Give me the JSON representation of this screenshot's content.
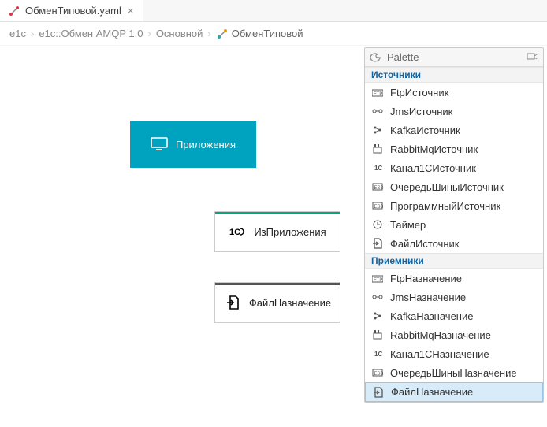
{
  "tab": {
    "label": "ОбменТиповой.yaml"
  },
  "breadcrumb": {
    "items": [
      "e1c",
      "e1c::Обмен AMQP 1.0",
      "Основной"
    ],
    "last": "ОбменТиповой"
  },
  "canvas": {
    "app": {
      "label": "Приложения"
    },
    "source": {
      "label": "ИзПриложения"
    },
    "dest": {
      "label": "ФайлНазначение"
    }
  },
  "palette": {
    "title": "Palette",
    "groups": [
      {
        "title": "Источники",
        "items": [
          {
            "label": "FtpИсточник",
            "icon": "ftp"
          },
          {
            "label": "JmsИсточник",
            "icon": "jms"
          },
          {
            "label": "KafkaИсточник",
            "icon": "kafka"
          },
          {
            "label": "RabbitMqИсточник",
            "icon": "rabbit"
          },
          {
            "label": "Канал1СИсточник",
            "icon": "onec"
          },
          {
            "label": "ОчередьШиныИсточник",
            "icon": "esb"
          },
          {
            "label": "ПрограммныйИсточник",
            "icon": "esb"
          },
          {
            "label": "Таймер",
            "icon": "timer"
          },
          {
            "label": "ФайлИсточник",
            "icon": "file"
          }
        ]
      },
      {
        "title": "Приемники",
        "items": [
          {
            "label": "FtpНазначение",
            "icon": "ftp"
          },
          {
            "label": "JmsНазначение",
            "icon": "jms"
          },
          {
            "label": "KafkaНазначение",
            "icon": "kafka"
          },
          {
            "label": "RabbitMqНазначение",
            "icon": "rabbit"
          },
          {
            "label": "Канал1СНазначение",
            "icon": "onec"
          },
          {
            "label": "ОчередьШиныНазначение",
            "icon": "esb"
          },
          {
            "label": "ФайлНазначение",
            "icon": "file",
            "selected": true
          }
        ]
      }
    ]
  }
}
